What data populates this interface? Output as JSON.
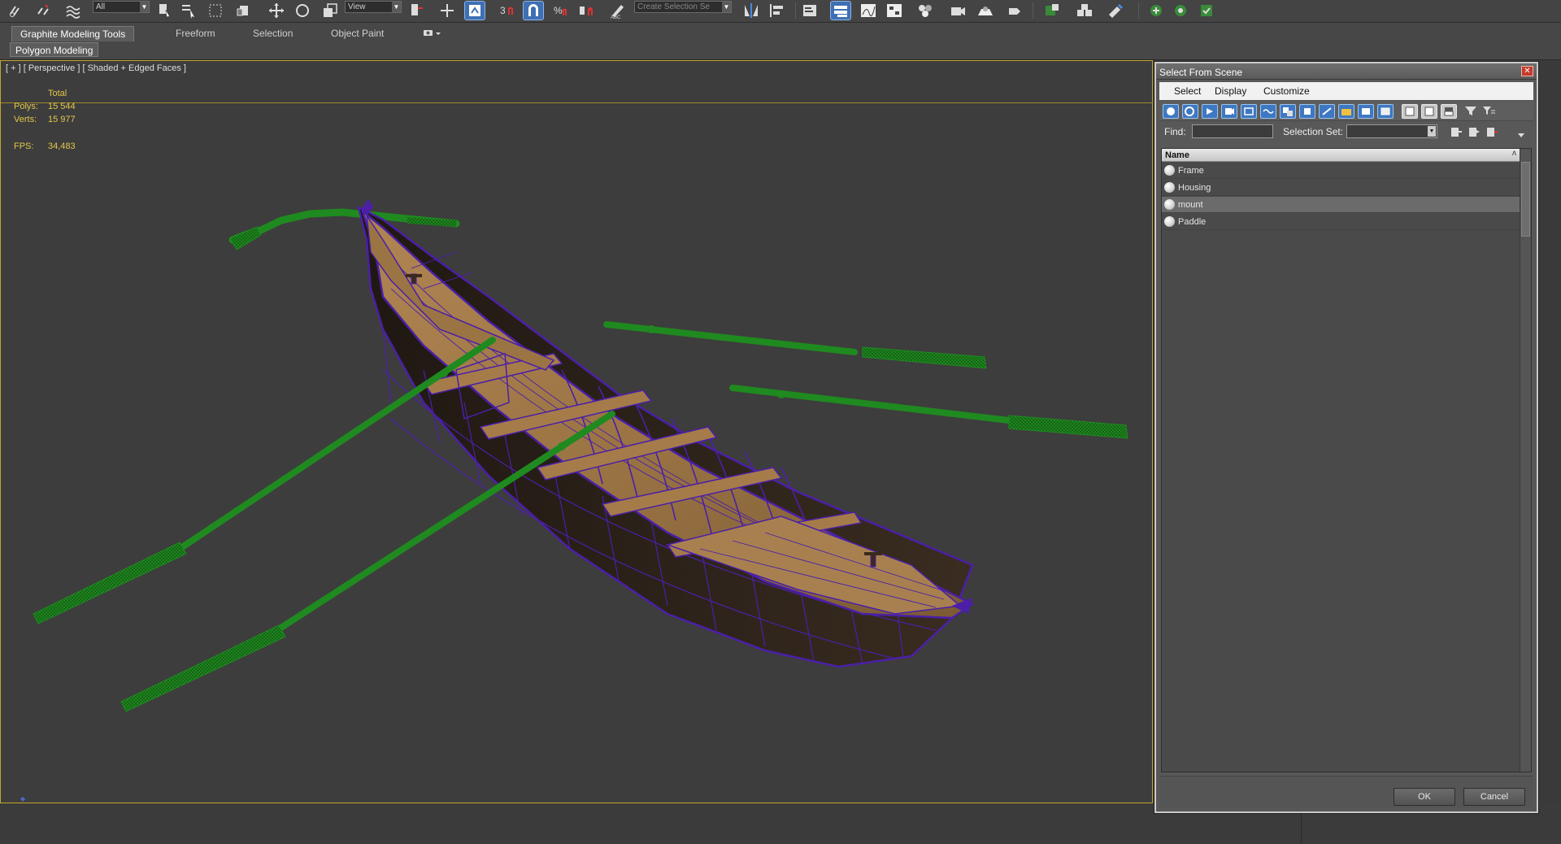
{
  "toolbar": {
    "selection_filter": "All",
    "ref_coord": "View",
    "named_selection_placeholder": "Create Selection Se"
  },
  "ribbon": {
    "tabs": [
      {
        "label": "Graphite Modeling Tools"
      },
      {
        "label": "Freeform"
      },
      {
        "label": "Selection"
      },
      {
        "label": "Object Paint"
      }
    ],
    "subtab": "Polygon Modeling"
  },
  "viewport": {
    "label": "[ + ] [ Perspective ] [ Shaded + Edged Faces ]",
    "stats": {
      "header": "Total",
      "polys_label": "Polys:",
      "polys_value": "15 544",
      "verts_label": "Verts:",
      "verts_value": "15 977",
      "fps_label": "FPS:",
      "fps_value": "34,483"
    },
    "colors": {
      "wire": "#4b1fa8",
      "oar": "#1f8a1f",
      "wood": "#9b7444",
      "hull_dark": "#2b2018",
      "frame": "#c3a72a"
    }
  },
  "dialog": {
    "title": "Select From Scene",
    "close_icon": "close-icon",
    "menu": [
      "Select",
      "Display",
      "Customize"
    ],
    "find_label": "Find:",
    "find_value": "",
    "selection_set_label": "Selection Set:",
    "selection_set_value": "",
    "list_header": "Name",
    "items": [
      {
        "name": "Frame",
        "selected": false
      },
      {
        "name": "Housing",
        "selected": false
      },
      {
        "name": "mount",
        "selected": true
      },
      {
        "name": "Paddle",
        "selected": false
      }
    ],
    "ok_label": "OK",
    "cancel_label": "Cancel"
  }
}
